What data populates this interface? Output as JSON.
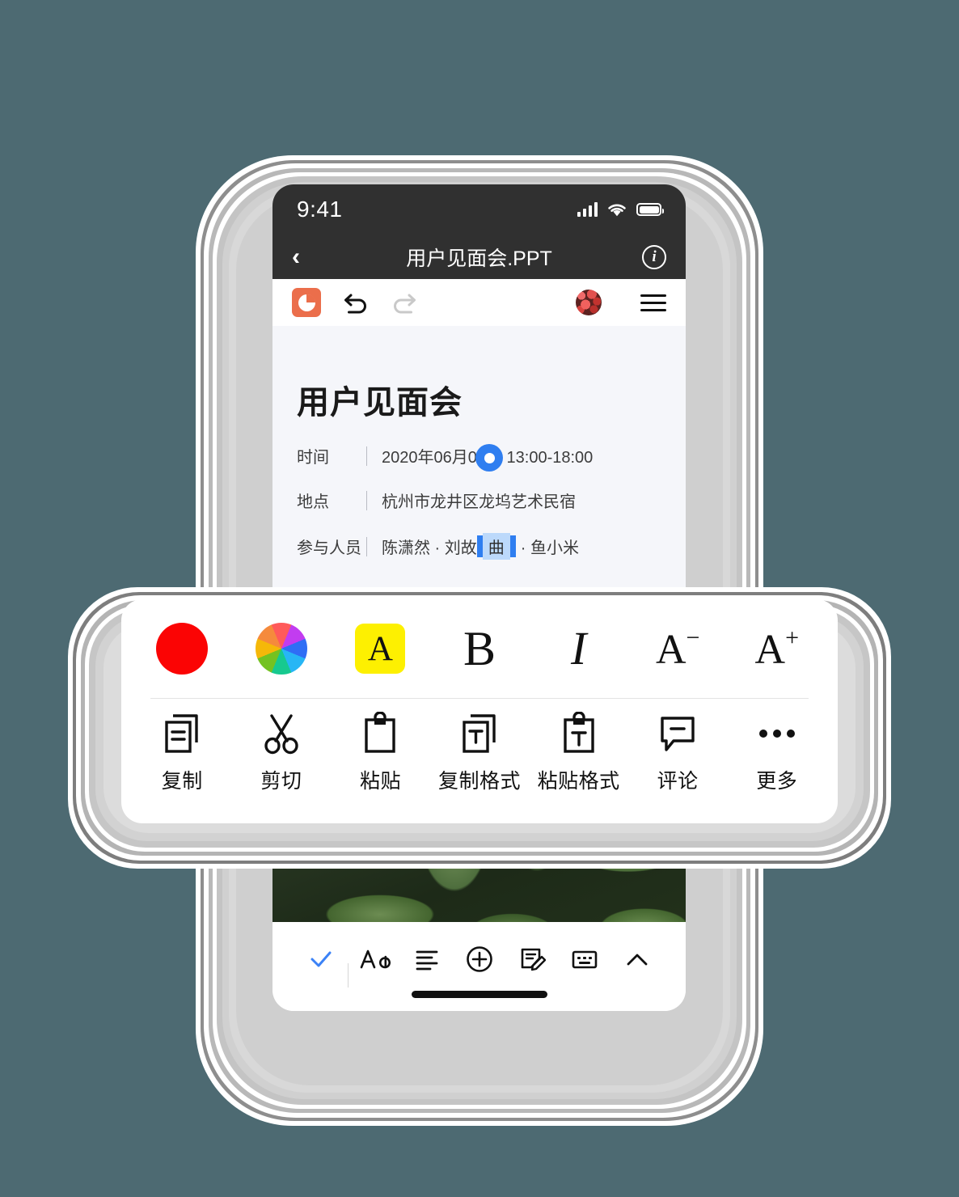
{
  "background_color": "#4d6a72",
  "statusbar": {
    "time": "9:41",
    "signal_icon": "cellular-signal-icon",
    "wifi_icon": "wifi-icon",
    "battery_icon": "battery-icon"
  },
  "navbar": {
    "back_icon": "chevron-left-icon",
    "title": "用户见面会.PPT",
    "info_label": "i",
    "info_icon": "info-circle-icon"
  },
  "edit_toolbar": {
    "app_icon": "ppt-app-icon",
    "undo_icon": "undo-arrow-icon",
    "redo_icon": "redo-arrow-icon",
    "avatar_icon": "user-avatar",
    "menu_icon": "hamburger-menu-icon"
  },
  "document": {
    "title": "用户见面会",
    "meta": [
      {
        "label": "时间",
        "value": "2020年06月05日    13:00-18:00"
      },
      {
        "label": "地点",
        "value": "杭州市龙井区龙坞艺术民宿"
      }
    ],
    "attendees": {
      "label": "参与人员",
      "before": "陈潇然 · 刘故",
      "selected": "曲",
      "after": "· 鱼小米"
    },
    "selection_handle_icon": "selection-handle-icon",
    "selection_highlight_color": "#bcd9fb",
    "selection_bar_color": "#2f7ef0",
    "photo_alt": "green-leaves-photo"
  },
  "format_toolbar": {
    "top_row": [
      {
        "name": "text-color-red-swatch",
        "icon": "red-circle-icon",
        "label": "",
        "color": "#fb0404"
      },
      {
        "name": "color-wheel-picker",
        "icon": "color-wheel-icon",
        "label": ""
      },
      {
        "name": "highlight-button",
        "icon": "highlight-a-icon",
        "label": "A",
        "color": "#fdf001"
      },
      {
        "name": "bold-button",
        "icon": "bold-icon",
        "label": "B"
      },
      {
        "name": "italic-button",
        "icon": "italic-icon",
        "label": "I"
      },
      {
        "name": "decrease-font-size-button",
        "icon": "font-decrease-icon",
        "label": "A",
        "sup": "−"
      },
      {
        "name": "increase-font-size-button",
        "icon": "font-increase-icon",
        "label": "A",
        "sup": "+"
      }
    ],
    "bottom_row": [
      {
        "name": "copy-button",
        "icon": "copy-icon",
        "label": "复制"
      },
      {
        "name": "cut-button",
        "icon": "scissors-icon",
        "label": "剪切"
      },
      {
        "name": "paste-button",
        "icon": "clipboard-icon",
        "label": "粘贴"
      },
      {
        "name": "copy-format-button",
        "icon": "copy-format-icon",
        "label": "复制格式"
      },
      {
        "name": "paste-format-button",
        "icon": "paste-format-icon",
        "label": "粘贴格式"
      },
      {
        "name": "comment-button",
        "icon": "comment-bubble-icon",
        "label": "评论"
      },
      {
        "name": "more-button",
        "icon": "ellipsis-icon",
        "label": "更多"
      }
    ]
  },
  "bottom_bar": {
    "items": [
      {
        "name": "confirm-check-button",
        "icon": "check-icon"
      },
      {
        "name": "font-style-button",
        "icon": "aa-font-icon"
      },
      {
        "name": "paragraph-align-button",
        "icon": "align-lines-icon"
      },
      {
        "name": "insert-button",
        "icon": "plus-circle-icon"
      },
      {
        "name": "annotate-button",
        "icon": "note-edit-icon"
      },
      {
        "name": "keyboard-button",
        "icon": "keyboard-icon"
      },
      {
        "name": "collapse-button",
        "icon": "chevron-up-icon"
      }
    ],
    "home_indicator": "home-indicator"
  }
}
